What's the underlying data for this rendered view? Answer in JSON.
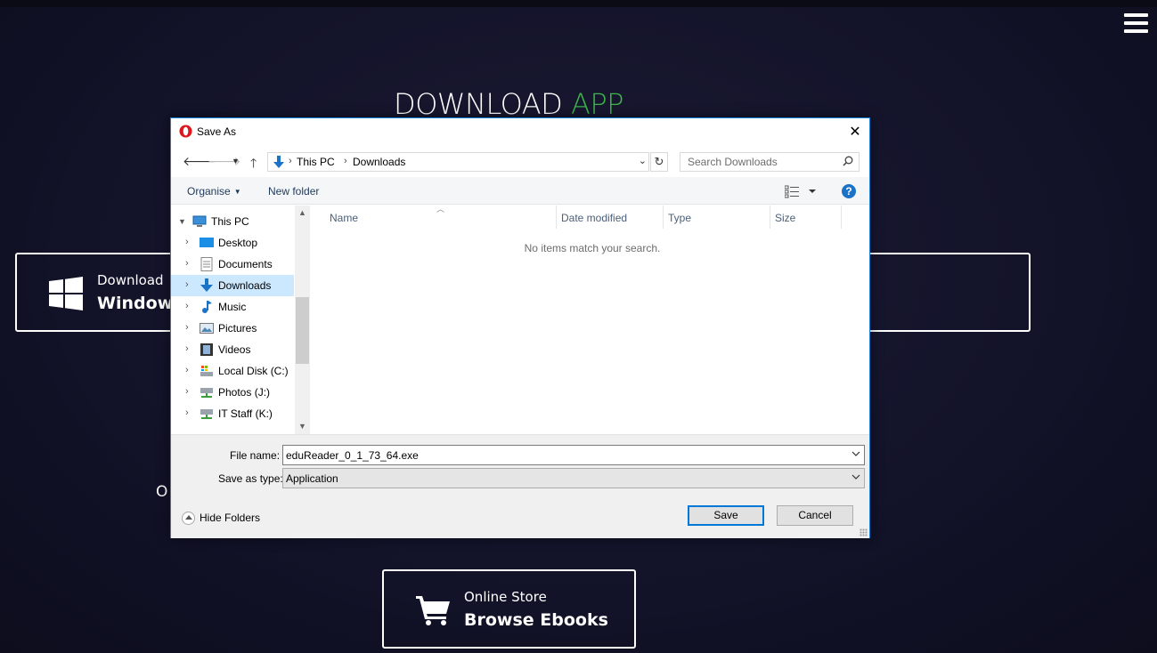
{
  "page": {
    "title_main": "DOWNLOAD",
    "title_accent": "APP",
    "accent_color": "#3cb44b",
    "menu_icon": "hamburger-menu-icon",
    "download_box": {
      "line1": "Download",
      "line2": "Windows",
      "icon": "windows-logo-icon"
    },
    "or_text": "O",
    "store_button": {
      "line1": "Online Store",
      "line2": "Browse Ebooks",
      "icon": "shopping-cart-icon"
    }
  },
  "dialog": {
    "title": "Save As",
    "app_icon": "opera-icon",
    "nav": {
      "back_icon": "arrow-left-icon",
      "forward_icon": "arrow-right-icon",
      "recent_icon": "chevron-down-icon",
      "up_icon": "arrow-up-icon",
      "breadcrumb": [
        "This PC",
        "Downloads"
      ],
      "refresh_icon": "refresh-icon",
      "search_placeholder": "Search Downloads"
    },
    "commands": {
      "organise": "Organise",
      "new_folder": "New folder",
      "view_icon": "view-options-icon",
      "help": "?"
    },
    "tree": [
      {
        "label": "This PC",
        "icon": "computer-icon",
        "expanded": true,
        "level": 0
      },
      {
        "label": "Desktop",
        "icon": "desktop-icon",
        "level": 1
      },
      {
        "label": "Documents",
        "icon": "documents-icon",
        "level": 1
      },
      {
        "label": "Downloads",
        "icon": "downloads-icon",
        "level": 1,
        "selected": true
      },
      {
        "label": "Music",
        "icon": "music-icon",
        "level": 1
      },
      {
        "label": "Pictures",
        "icon": "pictures-icon",
        "level": 1
      },
      {
        "label": "Videos",
        "icon": "videos-icon",
        "level": 1
      },
      {
        "label": "Local Disk (C:)",
        "icon": "local-disk-icon",
        "level": 1
      },
      {
        "label": "Photos (J:)",
        "icon": "network-drive-icon",
        "level": 1
      },
      {
        "label": "IT Staff (K:)",
        "icon": "network-drive-icon",
        "level": 1
      }
    ],
    "columns": [
      "Name",
      "Date modified",
      "Type",
      "Size"
    ],
    "empty_message": "No items match your search.",
    "file_name_label": "File name:",
    "file_name_value": "eduReader_0_1_73_64.exe",
    "save_type_label": "Save as type:",
    "save_type_value": "Application",
    "hide_folders": "Hide Folders",
    "save_label": "Save",
    "cancel_label": "Cancel"
  }
}
